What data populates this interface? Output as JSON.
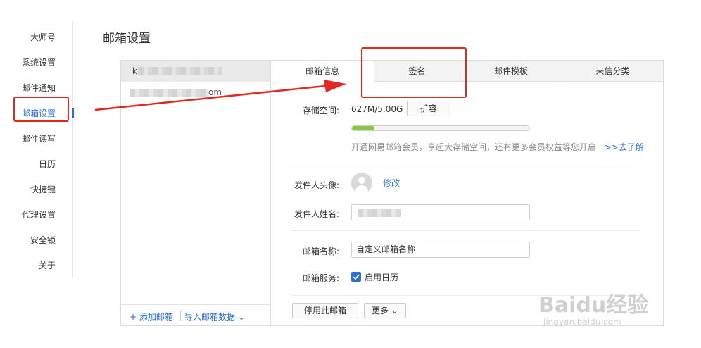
{
  "page": {
    "title": "邮箱设置"
  },
  "sidebar": {
    "items": [
      {
        "label": "大师号"
      },
      {
        "label": "系统设置"
      },
      {
        "label": "邮件通知"
      },
      {
        "label": "邮箱设置",
        "active": true
      },
      {
        "label": "邮件读写"
      },
      {
        "label": "日历"
      },
      {
        "label": "快捷键"
      },
      {
        "label": "代理设置"
      },
      {
        "label": "安全锁"
      },
      {
        "label": "关于"
      }
    ]
  },
  "accounts": {
    "first_initial": "k",
    "second_suffix": "om",
    "add_mailbox": "+ 添加邮箱",
    "import_data": "导入邮箱数据 ⌄"
  },
  "tabs": [
    {
      "label": "邮箱信息",
      "active": true
    },
    {
      "label": "签名"
    },
    {
      "label": "邮件模板"
    },
    {
      "label": "来信分类"
    }
  ],
  "storage": {
    "label": "存储空间:",
    "value": "627M/5.00G",
    "expand_button": "扩容",
    "usage_fraction": 0.125,
    "promo_text": "开通网易邮箱会员，享超大存储空间，还有更多会员权益等您开启",
    "promo_link": ">>去了解"
  },
  "sender": {
    "avatar_label": "发件人头像:",
    "modify_link": "修改",
    "name_label": "发件人姓名:"
  },
  "mailbox": {
    "name_label": "邮箱名称:",
    "name_value": "自定义邮箱名称",
    "service_label": "邮箱服务:",
    "calendar_option": "启用日历",
    "calendar_checked": true
  },
  "actions": {
    "disable_button": "停用此邮箱",
    "more_button": "更多 ⌄"
  },
  "watermark": {
    "brand": "Baidu经验",
    "url": "jingyan.baidu.com"
  },
  "colors": {
    "accent": "#2b6fd6",
    "annotation": "#e5281f",
    "progress": "#8cc63f"
  }
}
